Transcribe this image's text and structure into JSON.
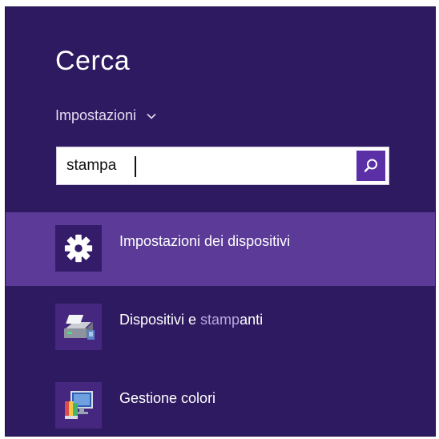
{
  "charm": {
    "title": "Cerca",
    "scope_label": "Impostazioni"
  },
  "search": {
    "query": "stampa",
    "button_icon": "search-icon"
  },
  "results": [
    {
      "label_before": "Impostazioni dei dispositivi",
      "label_match": "",
      "label_after": "",
      "icon": "gear-icon",
      "selected": true
    },
    {
      "label_before": "Dispositivi e ",
      "label_match": "stamp",
      "label_after": "anti",
      "icon": "printer-icon",
      "selected": false
    },
    {
      "label_before": "Gestione colori",
      "label_match": "",
      "label_after": "",
      "icon": "color-management-icon",
      "selected": false
    }
  ],
  "colors": {
    "background": "#2e1a61",
    "selected_row": "#5b3a98",
    "accent": "#5b2fa6",
    "match_highlight": "#b9a6de"
  }
}
